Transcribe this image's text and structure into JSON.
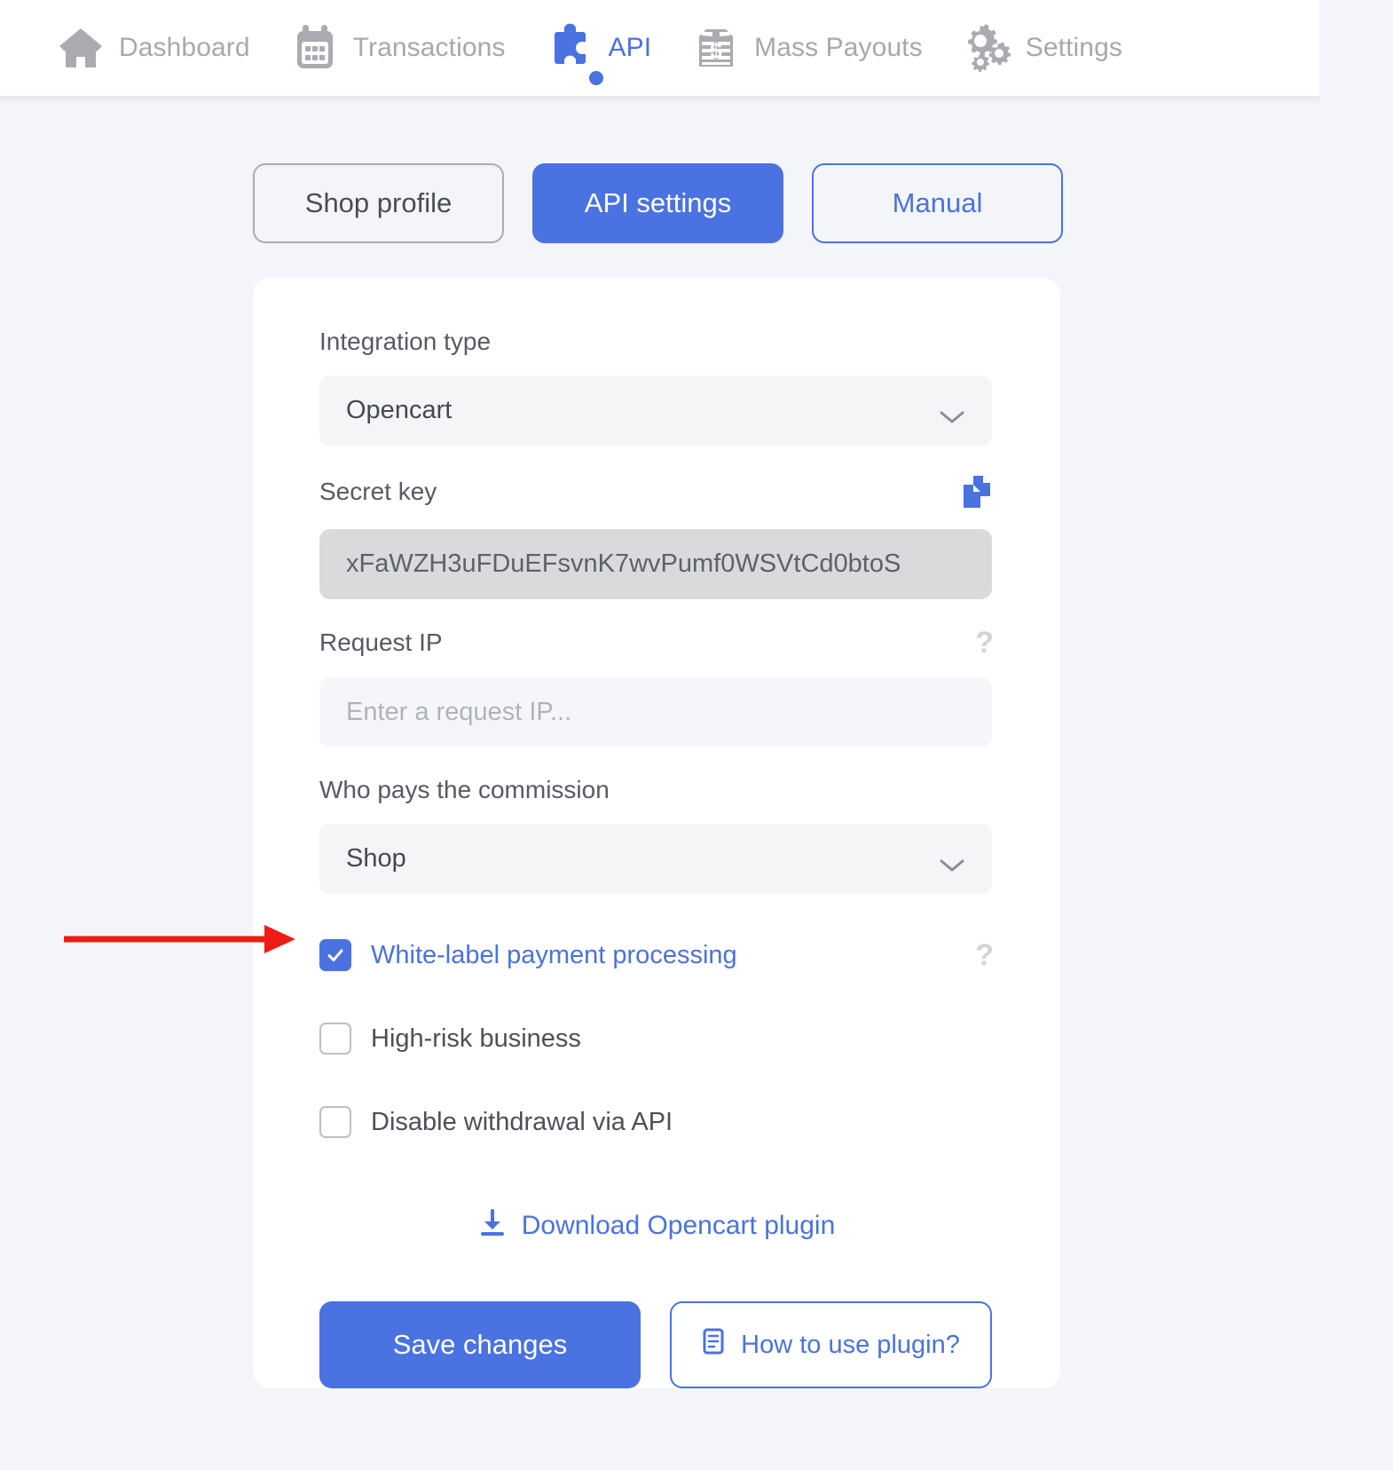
{
  "nav": {
    "items": [
      {
        "label": "Dashboard",
        "icon": "home-icon",
        "active": false
      },
      {
        "label": "Transactions",
        "icon": "calendar-icon",
        "active": false
      },
      {
        "label": "API",
        "icon": "puzzle-piece-icon",
        "active": true
      },
      {
        "label": "Mass Payouts",
        "icon": "money-stack-icon",
        "active": false
      },
      {
        "label": "Settings",
        "icon": "gears-icon",
        "active": false
      }
    ]
  },
  "tabs": [
    {
      "label": "Shop profile",
      "state": "inactive"
    },
    {
      "label": "API settings",
      "state": "active"
    },
    {
      "label": "Manual",
      "state": "outlined"
    }
  ],
  "form": {
    "integration_type": {
      "label": "Integration type",
      "value": "Opencart"
    },
    "secret_key": {
      "label": "Secret key",
      "value": "xFaWZH3uFDuEFsvnK7wvPumf0WSVtCd0btoS",
      "copy_icon": "copy-icon"
    },
    "request_ip": {
      "label": "Request IP",
      "value": "",
      "placeholder": "Enter a request IP...",
      "help": "?"
    },
    "commission": {
      "label": "Who pays the commission",
      "value": "Shop"
    },
    "checkboxes": [
      {
        "label": "White-label payment processing",
        "checked": true,
        "help": "?"
      },
      {
        "label": "High-risk business",
        "checked": false,
        "help": ""
      },
      {
        "label": "Disable withdrawal via API",
        "checked": false,
        "help": ""
      }
    ],
    "download_link": "Download Opencart plugin",
    "save_label": "Save changes",
    "how_to_label": "How to use plugin?"
  },
  "colors": {
    "accent": "#4a72e0",
    "page_bg": "#f4f5f9",
    "annotation": "#ee1c15"
  }
}
